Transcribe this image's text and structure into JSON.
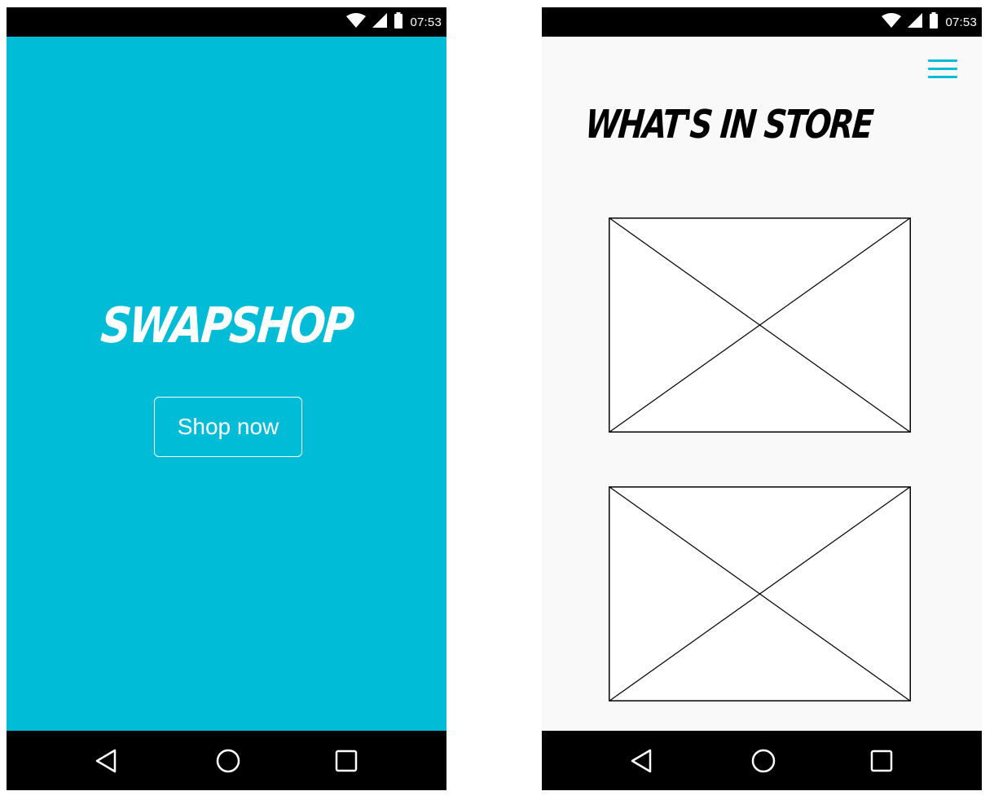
{
  "colors": {
    "accent": "#00bcd6",
    "status_bar": "#000000",
    "right_background": "#f9f9f9"
  },
  "status_bar": {
    "time": "07:53",
    "icons": [
      "wifi-icon",
      "cellular-signal-icon",
      "battery-icon"
    ]
  },
  "nav_bar": {
    "icons": [
      "back-icon",
      "home-icon",
      "recents-icon"
    ]
  },
  "splash_screen": {
    "brand": "SWAPSHOP",
    "button_label": "Shop now"
  },
  "store_screen": {
    "heading": "WHAT'S IN STORE",
    "menu_icon": "hamburger-menu-icon",
    "image_placeholders": [
      "image-placeholder",
      "image-placeholder"
    ]
  }
}
